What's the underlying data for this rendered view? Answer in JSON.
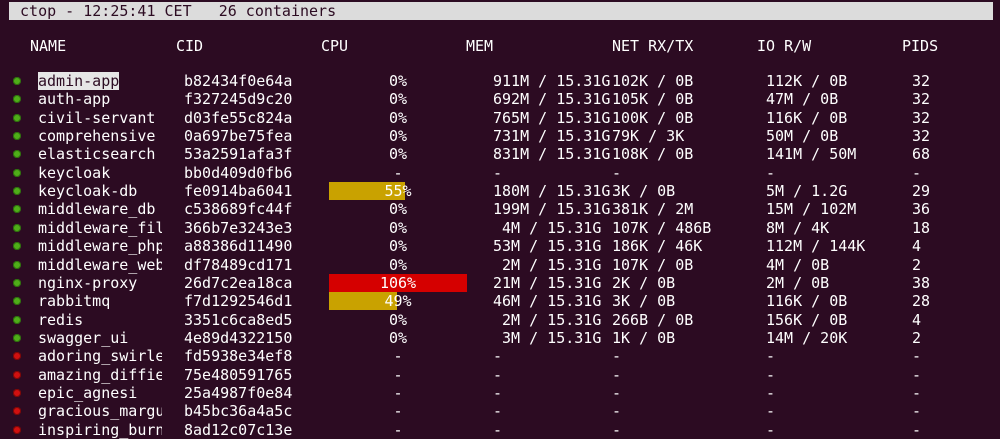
{
  "titlebar": {
    "text": " ctop - 12:25:41 CET   26 containers"
  },
  "columns": {
    "name": "NAME",
    "cid": "CID",
    "cpu": "CPU",
    "mem": "MEM",
    "net": "NET RX/TX",
    "io": "IO R/W",
    "pids": "PIDS"
  },
  "colors": {
    "bar_low": "#c9a200",
    "bar_high": "#d50000",
    "running": "#4fae19",
    "stopped": "#d01010"
  },
  "rows": [
    {
      "status": "running",
      "name": "admin-app",
      "cid": "b82434f0e64a",
      "cpu": "0%",
      "cpu_pct": 0,
      "mem": "911M / 15.31G",
      "net": "102K / 0B",
      "io": "112K / 0B",
      "pids": "32",
      "selected": true
    },
    {
      "status": "running",
      "name": "auth-app",
      "cid": "f327245d9c20",
      "cpu": "0%",
      "cpu_pct": 0,
      "mem": "692M / 15.31G",
      "net": "105K / 0B",
      "io": "47M / 0B",
      "pids": "32"
    },
    {
      "status": "running",
      "name": "civil-servant",
      "cid": "d03fe55c824a",
      "cpu": "0%",
      "cpu_pct": 0,
      "mem": "765M / 15.31G",
      "net": "100K / 0B",
      "io": "116K / 0B",
      "pids": "32"
    },
    {
      "status": "running",
      "name": "comprehensive",
      "cid": "0a697be75fea",
      "cpu": "0%",
      "cpu_pct": 0,
      "mem": "731M / 15.31G",
      "net": "79K / 3K",
      "io": "50M / 0B",
      "pids": "32"
    },
    {
      "status": "running",
      "name": "elasticsearch",
      "cid": "53a2591afa3f",
      "cpu": "0%",
      "cpu_pct": 0,
      "mem": "831M / 15.31G",
      "net": "108K / 0B",
      "io": "141M / 50M",
      "pids": "68"
    },
    {
      "status": "running",
      "name": "keycloak",
      "cid": "bb0d409d0fb6",
      "cpu": "-",
      "cpu_pct": 0,
      "mem": "-",
      "net": "-",
      "io": "-",
      "pids": "-"
    },
    {
      "status": "running",
      "name": "keycloak-db",
      "cid": "fe0914ba6041",
      "cpu": "55%",
      "cpu_pct": 55,
      "mem": "180M / 15.31G",
      "net": "3K / 0B",
      "io": "5M / 1.2G",
      "pids": "29"
    },
    {
      "status": "running",
      "name": "middleware_db",
      "cid": "c538689fc44f",
      "cpu": "0%",
      "cpu_pct": 0,
      "mem": "199M / 15.31G",
      "net": "381K / 2M",
      "io": "15M / 102M",
      "pids": "36"
    },
    {
      "status": "running",
      "name": "middleware_fil…",
      "cid": "366b7e3243e3",
      "cpu": "0%",
      "cpu_pct": 0,
      "mem": " 4M / 15.31G",
      "net": "107K / 486B",
      "io": "8M / 4K",
      "pids": "18"
    },
    {
      "status": "running",
      "name": "middleware_php",
      "cid": "a88386d11490",
      "cpu": "0%",
      "cpu_pct": 0,
      "mem": "53M / 15.31G",
      "net": "186K / 46K",
      "io": "112M / 144K",
      "pids": "4"
    },
    {
      "status": "running",
      "name": "middleware_web",
      "cid": "df78489cd171",
      "cpu": "0%",
      "cpu_pct": 0,
      "mem": " 2M / 15.31G",
      "net": "107K / 0B",
      "io": "4M / 0B",
      "pids": "2"
    },
    {
      "status": "running",
      "name": "nginx-proxy",
      "cid": "26d7c2ea18ca",
      "cpu": "106%",
      "cpu_pct": 100,
      "mem": "21M / 15.31G",
      "net": "2K / 0B",
      "io": "2M / 0B",
      "pids": "38"
    },
    {
      "status": "running",
      "name": "rabbitmq",
      "cid": "f7d1292546d1",
      "cpu": "49%",
      "cpu_pct": 49,
      "mem": "46M / 15.31G",
      "net": "3K / 0B",
      "io": "116K / 0B",
      "pids": "28"
    },
    {
      "status": "running",
      "name": "redis",
      "cid": "3351c6ca8ed5",
      "cpu": "0%",
      "cpu_pct": 0,
      "mem": " 2M / 15.31G",
      "net": "266B / 0B",
      "io": "156K / 0B",
      "pids": "4"
    },
    {
      "status": "running",
      "name": "swagger_ui",
      "cid": "4e89d4322150",
      "cpu": "0%",
      "cpu_pct": 0,
      "mem": " 3M / 15.31G",
      "net": "1K / 0B",
      "io": "14M / 20K",
      "pids": "2"
    },
    {
      "status": "stopped",
      "name": "adoring_swirles",
      "cid": "fd5938e34ef8",
      "cpu": "-",
      "cpu_pct": 0,
      "mem": "-",
      "net": "-",
      "io": "-",
      "pids": "-"
    },
    {
      "status": "stopped",
      "name": "amazing_diffie",
      "cid": "75e480591765",
      "cpu": "-",
      "cpu_pct": 0,
      "mem": "-",
      "net": "-",
      "io": "-",
      "pids": "-"
    },
    {
      "status": "stopped",
      "name": "epic_agnesi",
      "cid": "25a4987f0e84",
      "cpu": "-",
      "cpu_pct": 0,
      "mem": "-",
      "net": "-",
      "io": "-",
      "pids": "-"
    },
    {
      "status": "stopped",
      "name": "gracious_margu…",
      "cid": "b45bc36a4a5c",
      "cpu": "-",
      "cpu_pct": 0,
      "mem": "-",
      "net": "-",
      "io": "-",
      "pids": "-"
    },
    {
      "status": "stopped",
      "name": "inspiring_burn…",
      "cid": "8ad12c07c13e",
      "cpu": "-",
      "cpu_pct": 0,
      "mem": "-",
      "net": "-",
      "io": "-",
      "pids": "-"
    }
  ]
}
